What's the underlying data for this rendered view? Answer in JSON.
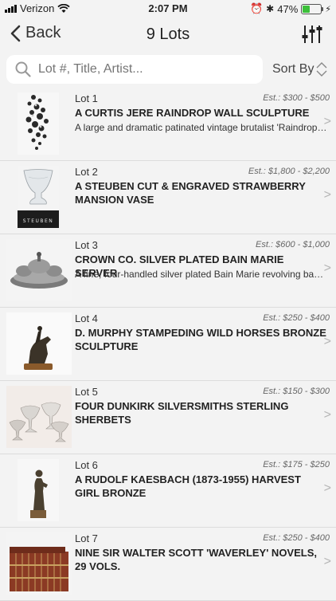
{
  "status": {
    "carrier": "Verizon",
    "time": "2:07 PM",
    "battery": "47%",
    "battery_level": 0.47
  },
  "nav": {
    "back_label": "Back",
    "title": "9 Lots"
  },
  "search": {
    "placeholder": "Lot #, Title, Artist..."
  },
  "sort_label": "Sort By",
  "lots": [
    {
      "lot": "Lot 1",
      "estimate": "Est.: $300 - $500",
      "title": "A CURTIS JERE RAINDROP WALL SCULPTURE",
      "description": "A large and dramatic patinated vintage brutalist 'Raindrop' wall sculpture",
      "image": "wall-sculpture"
    },
    {
      "lot": "Lot 2",
      "estimate": "Est.: $1,800 - $2,200",
      "title": "A STEUBEN CUT & ENGRAVED STRAWBERRY MANSION VASE",
      "description": "",
      "image": "crystal-vase",
      "image_caption": "STEUBEN"
    },
    {
      "lot": "Lot 3",
      "estimate": "Est.: $600 - $1,000",
      "title": "CROWN CO. SILVER PLATED BAIN MARIE SERVER",
      "description": "A fine, four-handled silver plated Bain Marie revolving base server",
      "image": "silver-server"
    },
    {
      "lot": "Lot 4",
      "estimate": "Est.: $250 - $400",
      "title": "D. MURPHY STAMPEDING WILD HORSES BRONZE SCULPTURE",
      "description": "",
      "image": "bronze-horses"
    },
    {
      "lot": "Lot 5",
      "estimate": "Est.: $150 - $300",
      "title": "FOUR DUNKIRK SILVERSMITHS STERLING SHERBETS",
      "description": "",
      "image": "sherbets"
    },
    {
      "lot": "Lot 6",
      "estimate": "Est.: $175 - $250",
      "title": "A RUDOLF KAESBACH (1873-1955) HARVEST GIRL BRONZE",
      "description": "",
      "image": "bronze-girl"
    },
    {
      "lot": "Lot 7",
      "estimate": "Est.: $250 - $400",
      "title": "NINE SIR WALTER SCOTT 'WAVERLEY' NOVELS, 29 VOLS.",
      "description": "",
      "image": "books"
    }
  ]
}
